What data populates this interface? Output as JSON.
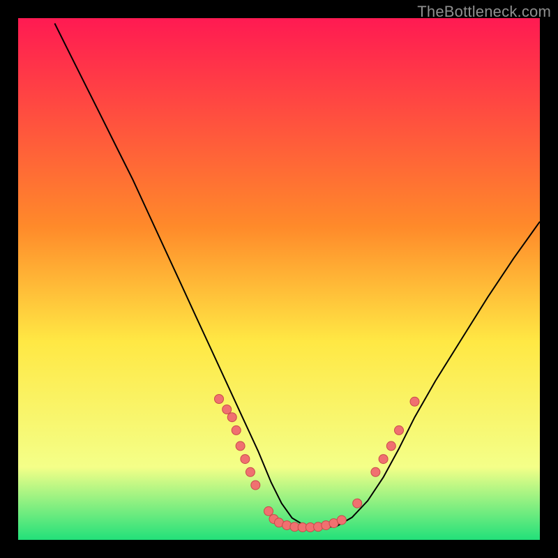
{
  "watermark": "TheBottleneck.com",
  "chart_data": {
    "type": "line",
    "title": "",
    "xlabel": "",
    "ylabel": "",
    "xlim": [
      0,
      100
    ],
    "ylim": [
      0,
      100
    ],
    "background_gradient": {
      "top": "#ff1a52",
      "mid1": "#ff8a2a",
      "mid2": "#ffe844",
      "mid3": "#f4ff88",
      "bottom": "#22e07a"
    },
    "series": [
      {
        "name": "curve",
        "color": "#000000",
        "x": [
          7,
          10,
          13,
          16,
          19,
          22,
          25,
          28,
          31,
          34,
          37,
          40,
          43,
          46,
          48.5,
          50.5,
          52.5,
          55,
          58,
          61,
          64,
          67,
          70,
          73,
          76,
          80,
          85,
          90,
          95,
          100
        ],
        "y": [
          99,
          93,
          87,
          81,
          75,
          69,
          62.5,
          56,
          49.5,
          43,
          36.5,
          30,
          23.5,
          17,
          11,
          7,
          4.2,
          2.7,
          2.3,
          2.6,
          4.3,
          7.5,
          12,
          17.5,
          23.5,
          30.5,
          38.5,
          46.5,
          54,
          61
        ]
      }
    ],
    "markers": {
      "color_fill": "#f07070",
      "color_stroke": "#c84a4a",
      "radius": 6.5,
      "points": [
        {
          "x": 38.5,
          "y": 27
        },
        {
          "x": 40.0,
          "y": 25
        },
        {
          "x": 41.0,
          "y": 23.5
        },
        {
          "x": 41.8,
          "y": 21.0
        },
        {
          "x": 42.6,
          "y": 18.0
        },
        {
          "x": 43.5,
          "y": 15.5
        },
        {
          "x": 44.5,
          "y": 13.0
        },
        {
          "x": 45.5,
          "y": 10.5
        },
        {
          "x": 48.0,
          "y": 5.5
        },
        {
          "x": 49.0,
          "y": 4.0
        },
        {
          "x": 50.0,
          "y": 3.3
        },
        {
          "x": 51.5,
          "y": 2.8
        },
        {
          "x": 53.0,
          "y": 2.5
        },
        {
          "x": 54.5,
          "y": 2.4
        },
        {
          "x": 56.0,
          "y": 2.4
        },
        {
          "x": 57.5,
          "y": 2.5
        },
        {
          "x": 59.0,
          "y": 2.8
        },
        {
          "x": 60.5,
          "y": 3.2
        },
        {
          "x": 62.0,
          "y": 3.8
        },
        {
          "x": 65.0,
          "y": 7.0
        },
        {
          "x": 68.5,
          "y": 13.0
        },
        {
          "x": 70.0,
          "y": 15.5
        },
        {
          "x": 71.5,
          "y": 18.0
        },
        {
          "x": 73.0,
          "y": 21.0
        },
        {
          "x": 76.0,
          "y": 26.5
        }
      ]
    }
  }
}
